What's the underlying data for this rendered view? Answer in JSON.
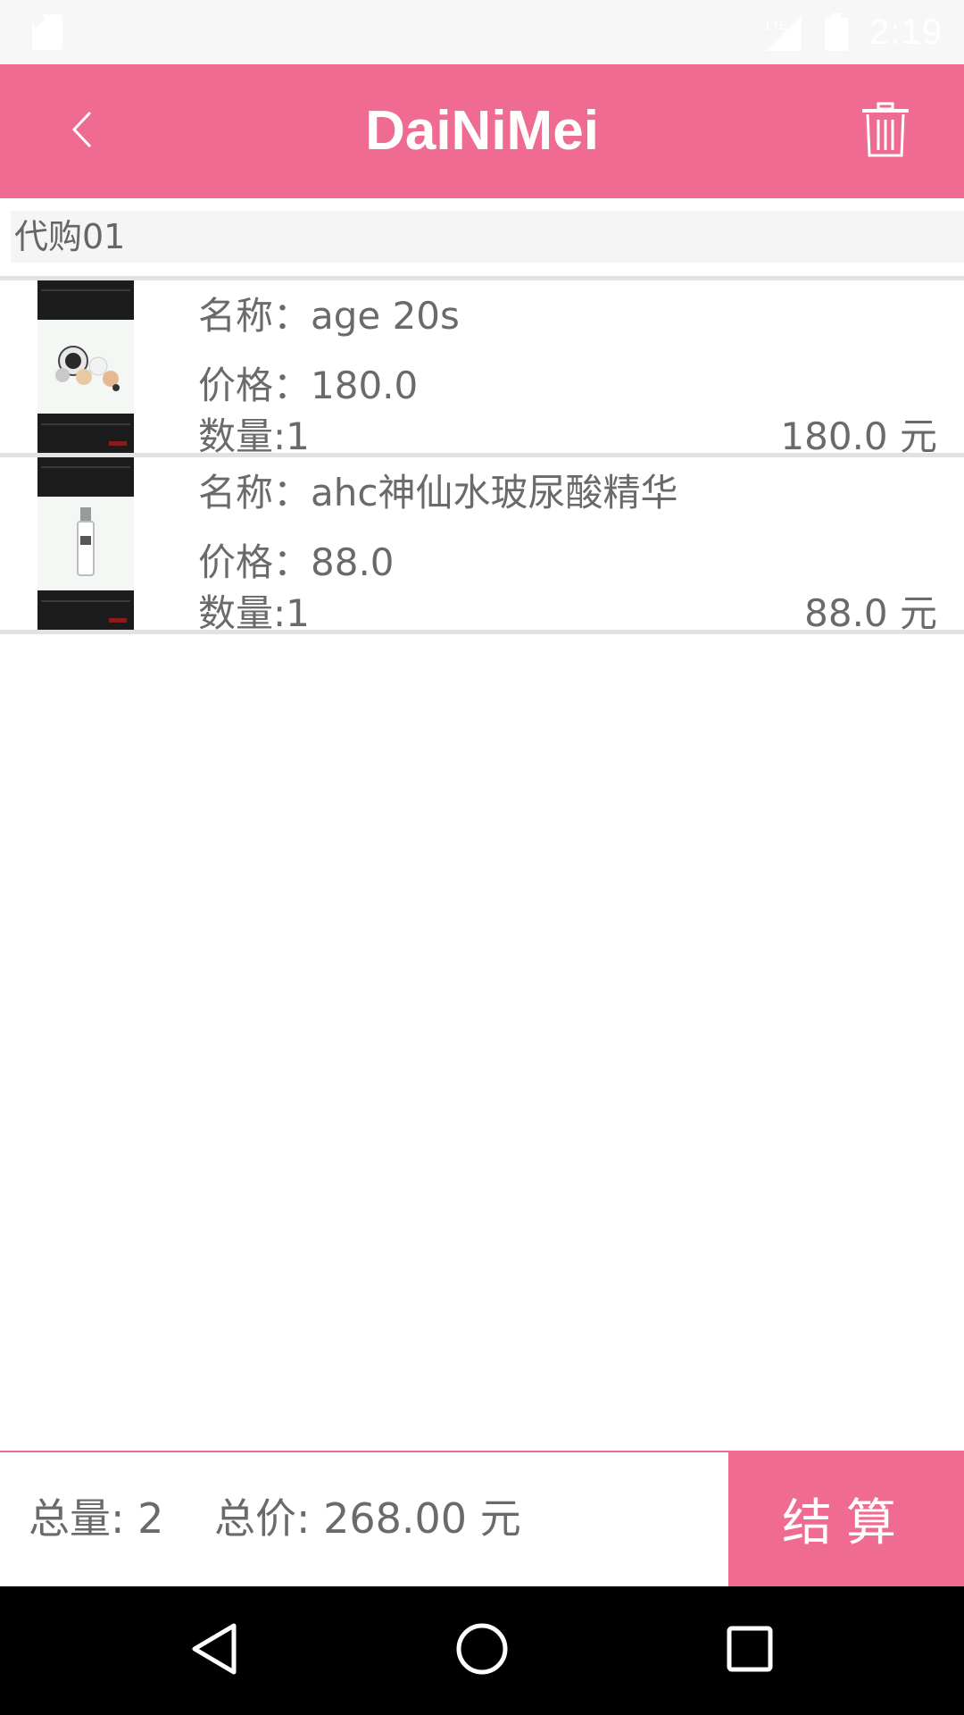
{
  "status_bar": {
    "time": "2:19",
    "icons": [
      "sd-card-icon",
      "signal-icon",
      "battery-icon"
    ]
  },
  "app_bar": {
    "title": "DaiNiMei",
    "back_icon": "chevron-left-icon",
    "delete_icon": "trash-icon"
  },
  "section": {
    "title": "代购01"
  },
  "items": [
    {
      "name": "名称：age 20s",
      "price": "价格：180.0",
      "quantity": "数量:1",
      "subtotal": "180.0 元",
      "thumbnail_icon": "compact-cushion-icon"
    },
    {
      "name": "名称：ahc神仙水玻尿酸精华",
      "price": "价格：88.0",
      "quantity": "数量:1",
      "subtotal": "88.0 元",
      "thumbnail_icon": "serum-bottle-icon"
    }
  ],
  "footer": {
    "total_quantity": "总量: 2",
    "total_price": "总价: 268.00 元",
    "checkout_label": "结算"
  },
  "nav": {
    "back": "triangle-back-icon",
    "home": "circle-home-icon",
    "recents": "square-recents-icon"
  },
  "colors": {
    "accent": "#f06b91",
    "text": "#6a6a6a",
    "nav_background": "#000000"
  }
}
